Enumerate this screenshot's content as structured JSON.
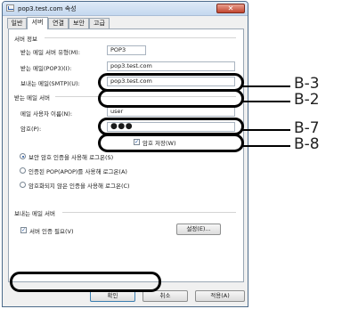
{
  "window": {
    "title": "pop3.test.com 속성",
    "close_label": "✕"
  },
  "tabs": [
    {
      "label": "일반"
    },
    {
      "label": "서버"
    },
    {
      "label": "연결"
    },
    {
      "label": "보안"
    },
    {
      "label": "고급"
    }
  ],
  "server_info": {
    "section": "서버 정보",
    "incoming_type_label": "받는 메일 서버 유형(M):",
    "incoming_type_value": "POP3",
    "incoming_label": "받는 메일(POP3)(I):",
    "incoming_value": "pop3.test.com",
    "outgoing_label": "보내는 메일(SMTP)(U):",
    "outgoing_value": "pop3.test.com"
  },
  "incoming_server": {
    "section": "받는 메일 서버",
    "username_label": "메일 사용자 이름(N):",
    "username_value": "user",
    "password_label": "암호(P):",
    "password_value": "●●●",
    "remember_label": "암호 저장(W)",
    "auth_options": [
      {
        "label": "보안 암호 인증을 사용해 로그온(S)",
        "selected": true
      },
      {
        "label": "인증된 POP(APOP)를 사용해 로그온(A)",
        "selected": false
      },
      {
        "label": "암호화되지 않은 인증을 사용해 로그온(C)",
        "selected": false
      }
    ]
  },
  "outgoing_server": {
    "section": "보내는 메일 서버",
    "auth_required_label": "서버 인증 필요(V)",
    "settings_button": "설정(E)..."
  },
  "buttons": {
    "ok": "확인",
    "cancel": "취소",
    "apply": "적용(A)"
  },
  "callouts": {
    "b3": "B-3",
    "b2": "B-2",
    "b7": "B-7",
    "b8": "B-8"
  },
  "colors": {
    "accent": "#1b4f9c",
    "close_button": "#c24630",
    "callout": "#000000"
  },
  "icons": [
    "app-icon",
    "close-icon",
    "checkbox-checked-icon"
  ]
}
